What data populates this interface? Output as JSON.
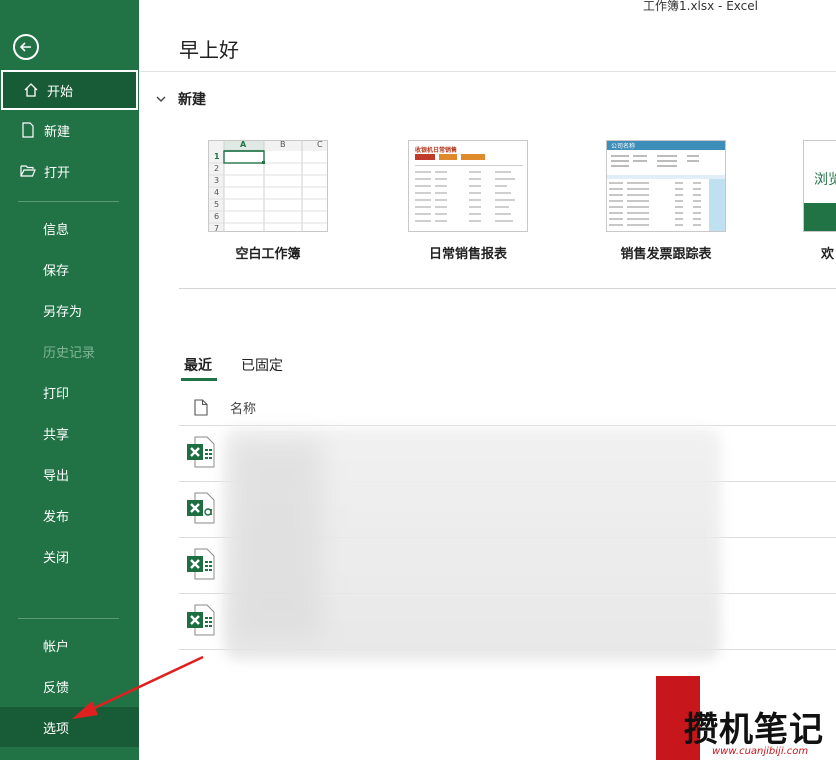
{
  "window_title": "工作簿1.xlsx  -  Excel",
  "greeting": "早上好",
  "sidebar": {
    "items": [
      {
        "label": "开始"
      },
      {
        "label": "新建"
      },
      {
        "label": "打开"
      },
      {
        "label": "信息"
      },
      {
        "label": "保存"
      },
      {
        "label": "另存为"
      },
      {
        "label": "历史记录"
      },
      {
        "label": "打印"
      },
      {
        "label": "共享"
      },
      {
        "label": "导出"
      },
      {
        "label": "发布"
      },
      {
        "label": "关闭"
      },
      {
        "label": "帐户"
      },
      {
        "label": "反馈"
      },
      {
        "label": "选项"
      }
    ]
  },
  "new_section": {
    "title": "新建",
    "templates": [
      {
        "label": "空白工作簿"
      },
      {
        "label": "日常销售报表"
      },
      {
        "label": "销售发票跟踪表"
      },
      {
        "label": "欢"
      }
    ],
    "blank_cols": [
      "A",
      "B",
      "C"
    ],
    "blank_rows": [
      "1",
      "2",
      "3",
      "4",
      "5",
      "6",
      "7"
    ],
    "sales_title": "收银机日常销售",
    "invoice_title": "公司名称",
    "welcome_text": "浏览"
  },
  "tabs": {
    "recent": "最近",
    "pinned": "已固定"
  },
  "file_list": {
    "name_header": "名称"
  },
  "watermark": {
    "text": "攒机笔记",
    "url": "www.cuanjibiji.com"
  },
  "colors": {
    "brand": "#217346",
    "brand_dark": "#185c37",
    "arrow": "#e02020"
  }
}
